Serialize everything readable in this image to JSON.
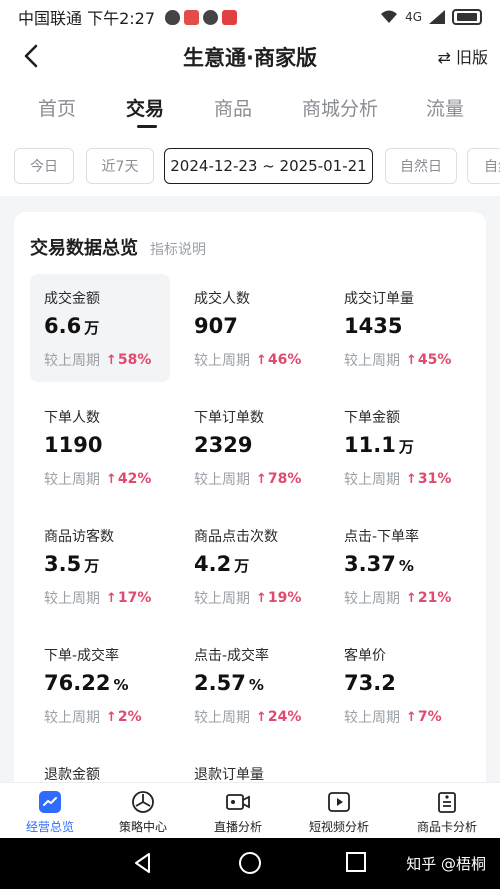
{
  "status_bar": {
    "carrier_time": "中国联通 下午2:27",
    "network": "4G"
  },
  "nav": {
    "title": "生意通·商家版",
    "old_version": "⇄ 旧版"
  },
  "tabs": [
    {
      "label": "首页"
    },
    {
      "label": "交易"
    },
    {
      "label": "商品"
    },
    {
      "label": "商城分析"
    },
    {
      "label": "流量"
    }
  ],
  "date_chips": [
    {
      "label": "今日"
    },
    {
      "label": "近7天"
    },
    {
      "label": "2024-12-23 ~ 2025-01-21"
    },
    {
      "label": "自然日"
    },
    {
      "label": "自然"
    }
  ],
  "card": {
    "title": "交易数据总览",
    "help": "指标说明",
    "compare_label": "较上周期",
    "metrics": [
      {
        "label": "成交金额",
        "value": "6.6",
        "unit": "万",
        "change": "58%"
      },
      {
        "label": "成交人数",
        "value": "907",
        "unit": "",
        "change": "46%"
      },
      {
        "label": "成交订单量",
        "value": "1435",
        "unit": "",
        "change": "45%"
      },
      {
        "label": "下单人数",
        "value": "1190",
        "unit": "",
        "change": "42%"
      },
      {
        "label": "下单订单数",
        "value": "2329",
        "unit": "",
        "change": "78%"
      },
      {
        "label": "下单金额",
        "value": "11.1",
        "unit": "万",
        "change": "31%"
      },
      {
        "label": "商品访客数",
        "value": "3.5",
        "unit": "万",
        "change": "17%"
      },
      {
        "label": "商品点击次数",
        "value": "4.2",
        "unit": "万",
        "change": "19%"
      },
      {
        "label": "点击-下单率",
        "value": "3.37",
        "unit": "%",
        "change": "21%"
      },
      {
        "label": "下单-成交率",
        "value": "76.22",
        "unit": "%",
        "change": "2%"
      },
      {
        "label": "点击-成交率",
        "value": "2.57",
        "unit": "%",
        "change": "24%"
      },
      {
        "label": "客单价",
        "value": "73.2",
        "unit": "",
        "change": "7%"
      },
      {
        "label": "退款金额"
      },
      {
        "label": "退款订单量"
      }
    ]
  },
  "bottom_tabs": [
    {
      "label": "经营总览",
      "icon": "chart-icon"
    },
    {
      "label": "策略中心",
      "icon": "strategy-icon"
    },
    {
      "label": "直播分析",
      "icon": "video-camera-icon"
    },
    {
      "label": "短视频分析",
      "icon": "play-icon"
    },
    {
      "label": "商品卡分析",
      "icon": "card-icon"
    }
  ],
  "colors": {
    "accent_blue": "#2f6bff",
    "change_red": "#e04a6e"
  },
  "watermark": "知乎 @梧桐"
}
